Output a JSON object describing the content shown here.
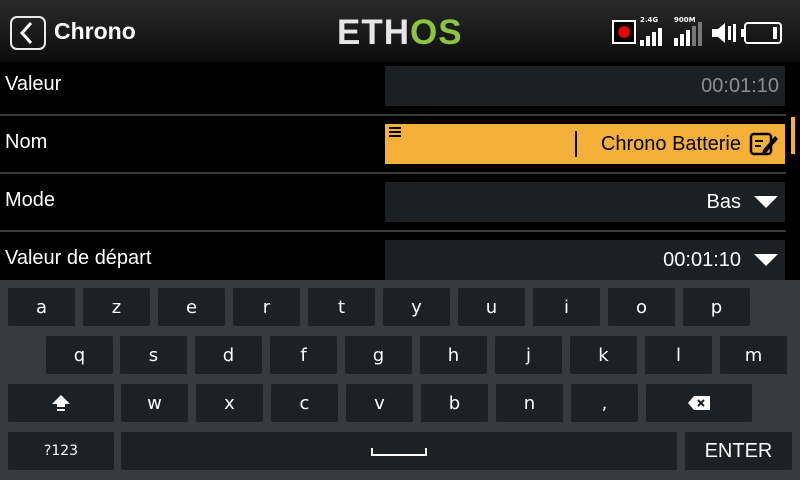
{
  "header": {
    "title": "Chrono",
    "logo": {
      "part1": "ETH",
      "part2": "OS"
    },
    "signal_24": "2.4G",
    "signal_900": "900M",
    "colors": {
      "logo_accent": "#8cc63f",
      "record": "#e00000"
    }
  },
  "rows": [
    {
      "label": "Valeur",
      "value": "00:01:10",
      "readonly": true
    },
    {
      "label": "Nom",
      "value": "Chrono Batterie",
      "active": true
    },
    {
      "label": "Mode",
      "value": "Bas",
      "dropdown": true
    },
    {
      "label": "Valeur de départ",
      "value": "00:01:10",
      "dropdown": true
    }
  ],
  "keyboard": {
    "row1": [
      "a",
      "z",
      "e",
      "r",
      "t",
      "y",
      "u",
      "i",
      "o",
      "p"
    ],
    "row2": [
      "q",
      "s",
      "d",
      "f",
      "g",
      "h",
      "j",
      "k",
      "l",
      "m"
    ],
    "row3": [
      "w",
      "x",
      "c",
      "v",
      "b",
      "n",
      ","
    ],
    "numbers_label": "?123",
    "enter_label": "ENTER"
  },
  "accent_color": "#f5b03a"
}
